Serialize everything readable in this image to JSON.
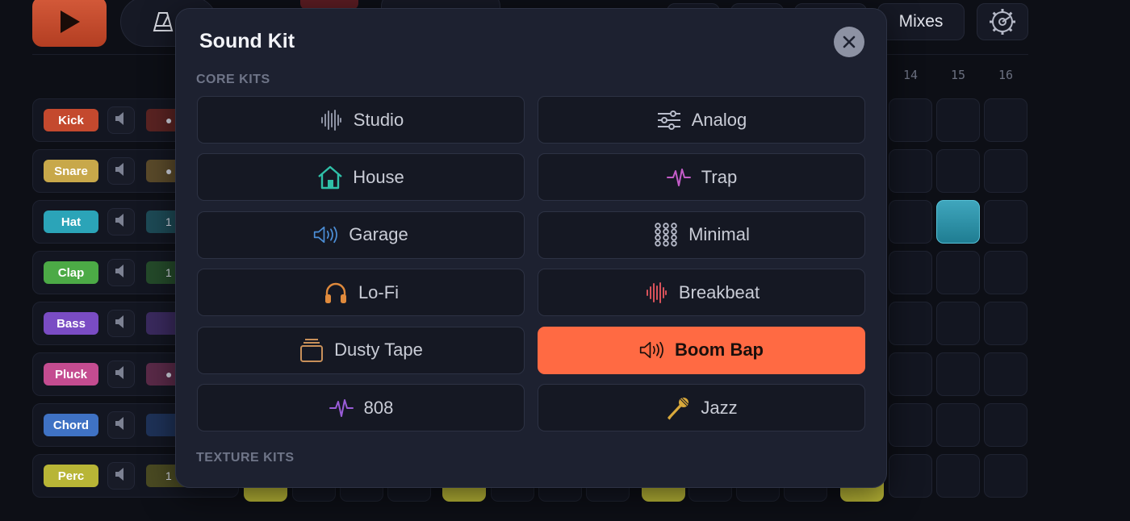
{
  "topbar": {
    "mixes_label": "Mixes"
  },
  "step_numbers": [
    "14",
    "15",
    "16"
  ],
  "tracks": [
    {
      "label": "Kick",
      "color": "#c4492e",
      "knob_text": "●",
      "knob_color": "#5a2322"
    },
    {
      "label": "Snare",
      "color": "#c8a84a",
      "knob_text": "●",
      "knob_color": "#5a4a2a"
    },
    {
      "label": "Hat",
      "color": "#2ba4b8",
      "knob_text": "1",
      "knob_color": "#1d4a56"
    },
    {
      "label": "Clap",
      "color": "#4caa46",
      "knob_text": "1",
      "knob_color": "#244a2a"
    },
    {
      "label": "Bass",
      "color": "#7a4cc4",
      "knob_text": "",
      "knob_color": "#3a2a5e"
    },
    {
      "label": "Pluck",
      "color": "#c44c90",
      "knob_text": "●",
      "knob_color": "#5a2a48"
    },
    {
      "label": "Chord",
      "color": "#3f72c4",
      "knob_text": "",
      "knob_color": "#1e3258"
    },
    {
      "label": "Perc",
      "color": "#b8b536",
      "knob_text": "1",
      "knob_color": "#4a4a22"
    }
  ],
  "modal": {
    "title": "Sound Kit",
    "close_label": "✕",
    "sections": [
      {
        "label": "CORE KITS"
      },
      {
        "label": "TEXTURE KITS"
      }
    ],
    "kits": [
      {
        "label": "Studio",
        "icon": "waveform-icon",
        "icon_color": "#8d92a3",
        "selected": false
      },
      {
        "label": "Analog",
        "icon": "sliders-icon",
        "icon_color": "#b8bccb",
        "selected": false
      },
      {
        "label": "House",
        "icon": "house-icon",
        "icon_color": "#2fc0a8",
        "selected": false
      },
      {
        "label": "Trap",
        "icon": "pulse-icon",
        "icon_color": "#c45cc8",
        "selected": false
      },
      {
        "label": "Garage",
        "icon": "speaker-icon",
        "icon_color": "#4c8fd8",
        "selected": false
      },
      {
        "label": "Minimal",
        "icon": "dots-grid-icon",
        "icon_color": "#b8bccb",
        "selected": false
      },
      {
        "label": "Lo-Fi",
        "icon": "headphones-icon",
        "icon_color": "#e08a3c",
        "selected": false
      },
      {
        "label": "Breakbeat",
        "icon": "waveform-icon",
        "icon_color": "#d8525a",
        "selected": false
      },
      {
        "label": "Dusty Tape",
        "icon": "tape-stack-icon",
        "icon_color": "#c8905a",
        "selected": false
      },
      {
        "label": "Boom Bap",
        "icon": "speaker-icon",
        "icon_color": "#1a0f0c",
        "selected": true
      },
      {
        "label": "808",
        "icon": "pulse-icon",
        "icon_color": "#9a5cd8",
        "selected": false
      },
      {
        "label": "Jazz",
        "icon": "microphone-icon",
        "icon_color": "#d8a83c",
        "selected": false
      }
    ]
  }
}
